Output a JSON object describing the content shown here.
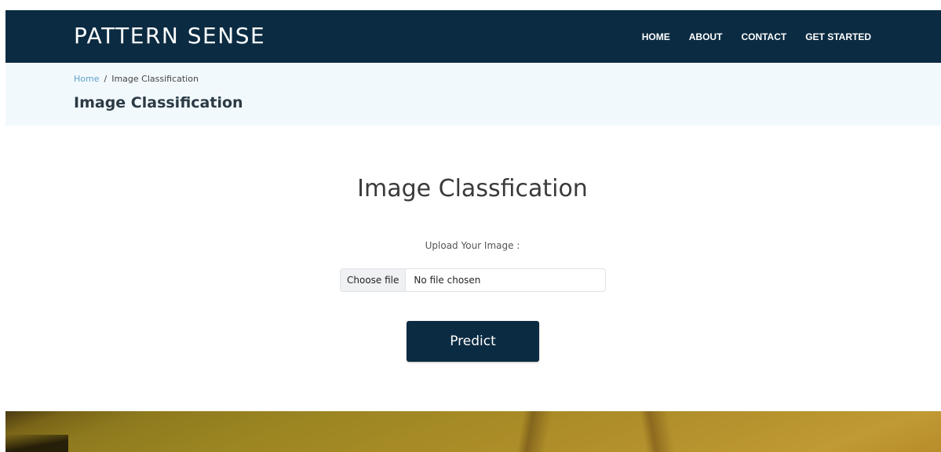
{
  "navbar": {
    "brand": "PATTERN SENSE",
    "links": [
      "HOME",
      "ABOUT",
      "CONTACT",
      "GET STARTED"
    ],
    "background": "#0b2b42"
  },
  "breadcrumb": {
    "home": "Home",
    "separator": "/",
    "current": "Image Classification",
    "page_title": "Image Classification"
  },
  "main": {
    "title": "Image Classfication",
    "upload_label": "Upload Your Image :",
    "file_input": {
      "button_label": "Choose file",
      "status": "No file chosen"
    },
    "predict_label": "Predict"
  },
  "colors": {
    "accent": "#0b2b42",
    "breadcrumb_bg": "#f2f9fd",
    "link": "#5f9ec8"
  }
}
